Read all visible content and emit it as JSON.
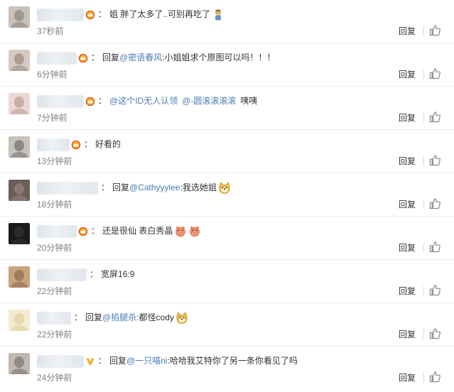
{
  "reply_label": "回复",
  "colors": {
    "link": "#4a7bb4",
    "time": "#808080",
    "crown": "#f5a623",
    "vip": "#f5a623"
  },
  "comments": [
    {
      "badge": "crown-icon",
      "time": "37秒前",
      "parts": [
        {
          "t": "text",
          "v": "姐 胖了太多了..可别再吃了"
        },
        {
          "t": "emoji",
          "name": "doll-emoji"
        }
      ]
    },
    {
      "badge": "crown-icon",
      "time": "6分钟前",
      "parts": [
        {
          "t": "text",
          "v": "回复"
        },
        {
          "t": "link",
          "v": "@密语春风"
        },
        {
          "t": "text",
          "v": ":小姐姐求个原图可以吗！！！"
        }
      ]
    },
    {
      "badge": "crown-icon",
      "time": "7分钟前",
      "parts": [
        {
          "t": "link",
          "v": "@这个ID无人认领"
        },
        {
          "t": "space"
        },
        {
          "t": "link",
          "v": "@-圆滚滚滚滚"
        },
        {
          "t": "space"
        },
        {
          "t": "text",
          "v": "咦咦"
        }
      ]
    },
    {
      "badge": "crown-icon",
      "time": "13分钟前",
      "parts": [
        {
          "t": "text",
          "v": "好看的"
        }
      ]
    },
    {
      "badge": "",
      "time": "18分钟前",
      "parts": [
        {
          "t": "text",
          "v": "回复"
        },
        {
          "t": "link",
          "v": "@Cathyyylee"
        },
        {
          "t": "text",
          "v": ":我选她姐"
        },
        {
          "t": "emoji",
          "name": "doge-emoji"
        }
      ]
    },
    {
      "badge": "crown-icon",
      "time": "20分钟前",
      "parts": [
        {
          "t": "text",
          "v": "还是很仙 表白秀晶"
        },
        {
          "t": "emoji",
          "name": "pig-emoji"
        },
        {
          "t": "emoji",
          "name": "pig-emoji"
        }
      ]
    },
    {
      "badge": "",
      "time": "22分钟前",
      "parts": [
        {
          "t": "text",
          "v": "宽屏16:9"
        }
      ]
    },
    {
      "badge": "",
      "time": "22分钟前",
      "parts": [
        {
          "t": "text",
          "v": "回复"
        },
        {
          "t": "link",
          "v": "@掐腿杀"
        },
        {
          "t": "text",
          "v": ":都怪cody"
        },
        {
          "t": "emoji",
          "name": "doge-emoji"
        }
      ]
    },
    {
      "badge": "vip-v-icon",
      "time": "24分钟前",
      "parts": [
        {
          "t": "text",
          "v": "回复"
        },
        {
          "t": "link",
          "v": "@一只喵ni"
        },
        {
          "t": "text",
          "v": ":哈哈我艾特你了另一条你看见了吗"
        }
      ]
    }
  ]
}
